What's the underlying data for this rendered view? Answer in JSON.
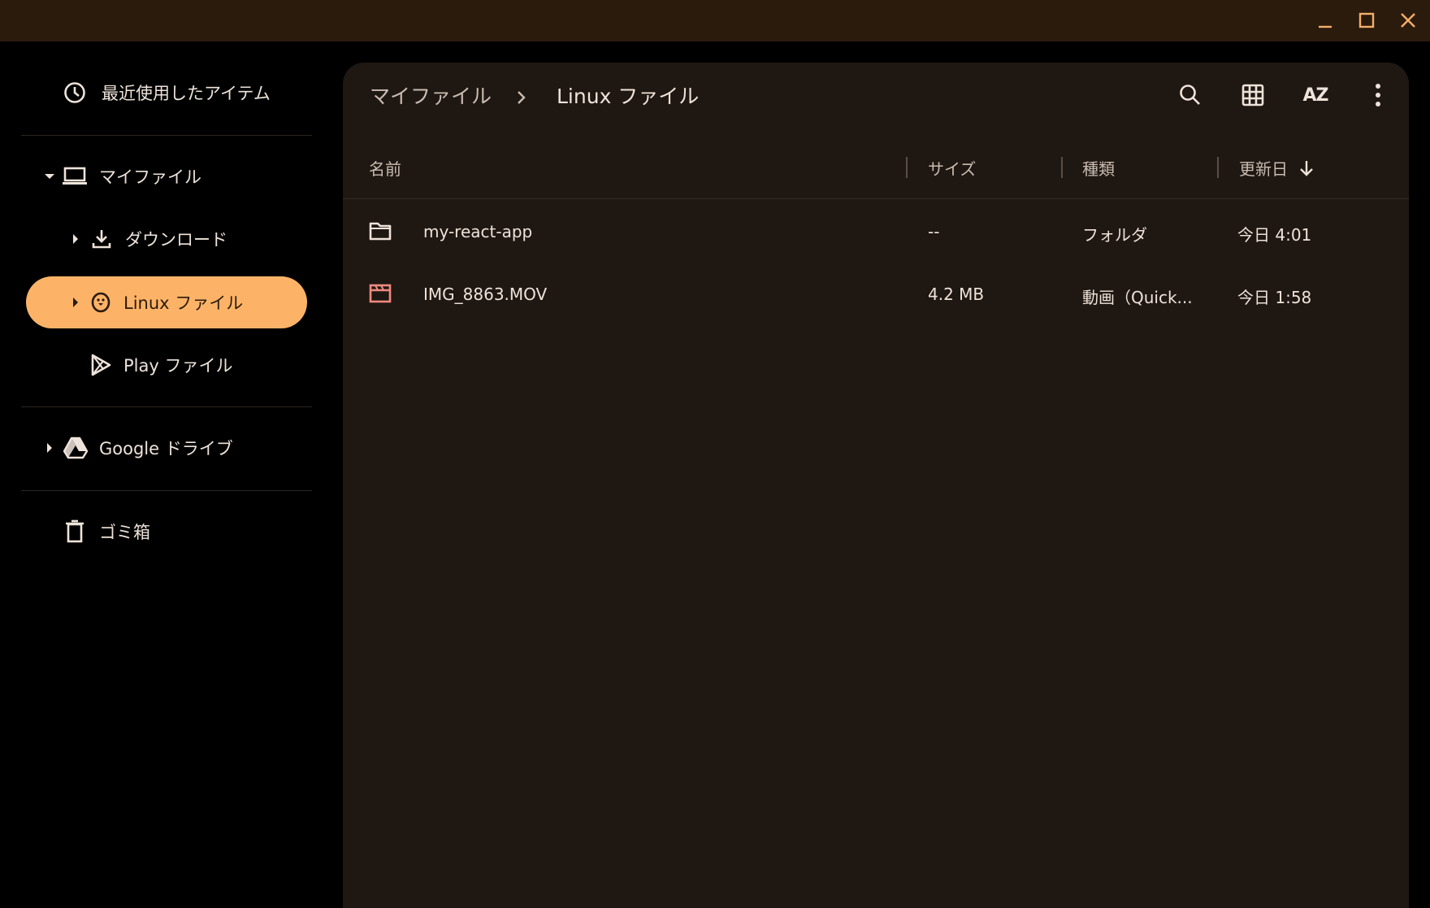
{
  "window": {
    "minimize_icon": "minimize-icon",
    "maximize_icon": "maximize-icon",
    "close_icon": "close-icon",
    "accent": "#f5ae6a",
    "titlebar_color": "#2b1b0c"
  },
  "sidebar": {
    "recent": {
      "label": "最近使用したアイテム",
      "icon": "clock-icon"
    },
    "my_files": {
      "label": "マイファイル",
      "icon": "laptop-icon"
    },
    "downloads": {
      "label": "ダウンロード",
      "icon": "download-icon"
    },
    "linux_files": {
      "label": "Linux ファイル",
      "icon": "penguin-icon",
      "active_color": "#fdb367"
    },
    "play_files": {
      "label": "Play ファイル",
      "icon": "play-store-icon"
    },
    "google_drive": {
      "label": "Google ドライブ",
      "icon": "drive-icon"
    },
    "trash": {
      "label": "ゴミ箱",
      "icon": "trash-icon"
    }
  },
  "breadcrumb": {
    "root": "マイファイル",
    "current": "Linux ファイル"
  },
  "toolbar": {
    "search_icon": "search-icon",
    "grid_icon": "grid-view-icon",
    "sort_label": "AZ",
    "more_icon": "more-vert-icon"
  },
  "columns": {
    "name": "名前",
    "size": "サイズ",
    "type": "種類",
    "modified": "更新日"
  },
  "files": [
    {
      "name": "my-react-app",
      "size": "--",
      "type": "フォルダ",
      "modified": "今日 4:01",
      "icon": "folder-icon"
    },
    {
      "name": "IMG_8863.MOV",
      "size": "4.2 MB",
      "type": "動画（Quick...",
      "modified": "今日 1:58",
      "icon": "video-icon"
    }
  ]
}
